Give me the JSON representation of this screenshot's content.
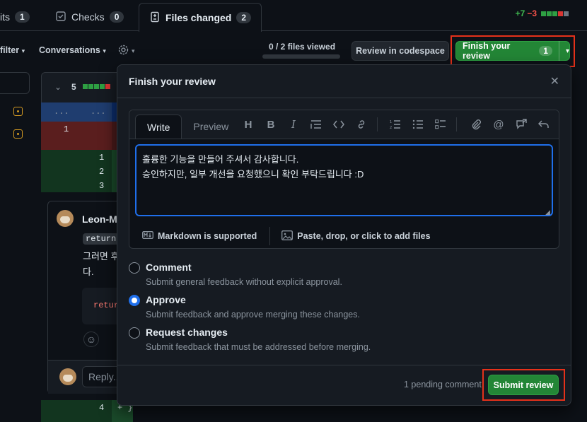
{
  "tabs": {
    "commits_label": "its",
    "commits_count": "1",
    "checks_label": "Checks",
    "checks_count": "0",
    "files_label": "Files changed",
    "files_count": "2"
  },
  "diffstat": {
    "added": "+7",
    "removed": "−3"
  },
  "toolbar": {
    "filter_label": "filter",
    "conversations_label": "Conversations",
    "files_viewed": "0 / 2 files viewed",
    "codespace_label": "Review in codespace",
    "finish_review_label": "Finish your review",
    "finish_review_count": "1"
  },
  "background": {
    "file_collapse_count": "5",
    "hunk_marker_left": "...",
    "hunk_marker_right": "...",
    "line_old_1": "1",
    "line_new_1": "1",
    "line_new_2": "2",
    "line_new_3": "3",
    "comment_author": "Leon-M",
    "comment_code": "return",
    "comment_text_1": "그러면 후",
    "comment_text_2": "다.",
    "comment_code_block": "retur",
    "reply_placeholder": "Reply...",
    "line_new_4": "4",
    "line_4_code": "+ }"
  },
  "modal": {
    "title": "Finish your review",
    "write_tab": "Write",
    "preview_tab": "Preview",
    "body_text": "훌륭한 기능을 만들어 주셔서 감사합니다.\n승인하지만, 일부 개선을 요청했으니 확인 부탁드립니다 :D",
    "markdown_label": "Markdown is supported",
    "attach_label": "Paste, drop, or click to add files",
    "options": [
      {
        "title": "Comment",
        "desc": "Submit general feedback without explicit approval."
      },
      {
        "title": "Approve",
        "desc": "Submit feedback and approve merging these changes."
      },
      {
        "title": "Request changes",
        "desc": "Submit feedback that must be addressed before merging."
      }
    ],
    "selected_option": "Approve",
    "pending_text": "1 pending comment",
    "submit_label": "Submit review"
  },
  "colors": {
    "accent_green": "#238636",
    "accent_blue": "#1f6feb",
    "highlight_red": "#e5311a",
    "added_text": "#3fb950",
    "removed_text": "#f85149"
  }
}
